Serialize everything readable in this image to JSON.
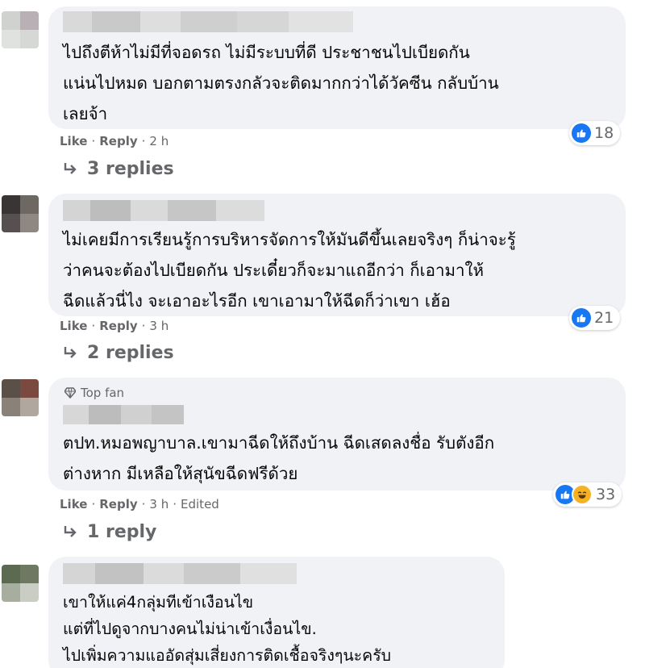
{
  "comments": [
    {
      "text": "ไปถึงตีห้าไม่มีที่จอดรถ ไม่มีระบบที่ดี ประชาชนไปเบียดกัน\nแน่นไปหมด บอกตามตรงกลัวจะติดมากกว่าได้วัคซีน กลับบ้าน\nเลยจ้า",
      "reaction_count": "18",
      "reactions": [
        "like-icon"
      ],
      "like_label": "Like",
      "reply_label": "Reply",
      "time": "2 h",
      "replies_label": "3 replies"
    },
    {
      "text": "ไม่เคยมีการเรียนรู้การบริหารจัดการให้มันดีขึ้นเลยจริงๆ ก็น่าจะรู้\nว่าคนจะต้องไปเบียดกัน ประเดี๋ยวก็จะมาแถอีกว่า ก็เอามาให้\nฉีดแล้วนี่ไง จะเอาอะไรอีก เขาเอามาให้ฉีดก็ว่าเขา เฮ้อ",
      "reaction_count": "21",
      "reactions": [
        "like-icon"
      ],
      "like_label": "Like",
      "reply_label": "Reply",
      "time": "3 h",
      "replies_label": "2 replies"
    },
    {
      "badge": "Top fan",
      "text": "ตปท.หมอพญาบาล.เขามาฉีดให้ถึงบ้าน ฉีดเสดลงชื่อ รับตังอีก\nต่างหาก มีเหลือให้สุนัขฉีดฟรีด้วย",
      "reaction_count": "33",
      "reactions": [
        "like-icon",
        "haha-icon"
      ],
      "like_label": "Like",
      "reply_label": "Reply",
      "time": "3 h",
      "edited_label": "Edited",
      "replies_label": "1 reply"
    },
    {
      "text": "เขาให้แค่4กลุ่มทีเข้าเงือนไข\nแต่ที่ไปดูจากบางคนไม่น่าเข้าเงื่อนไข.\nไปเพิ่มความแออัดสุ่มเสี่ยงการติดเชื้อจริงๆนะครับ"
    }
  ],
  "colors": {
    "bubble": "#f0f2f5",
    "meta": "#65676b",
    "like_blue": "#1877f2",
    "haha_yellow": "#f7b125"
  }
}
